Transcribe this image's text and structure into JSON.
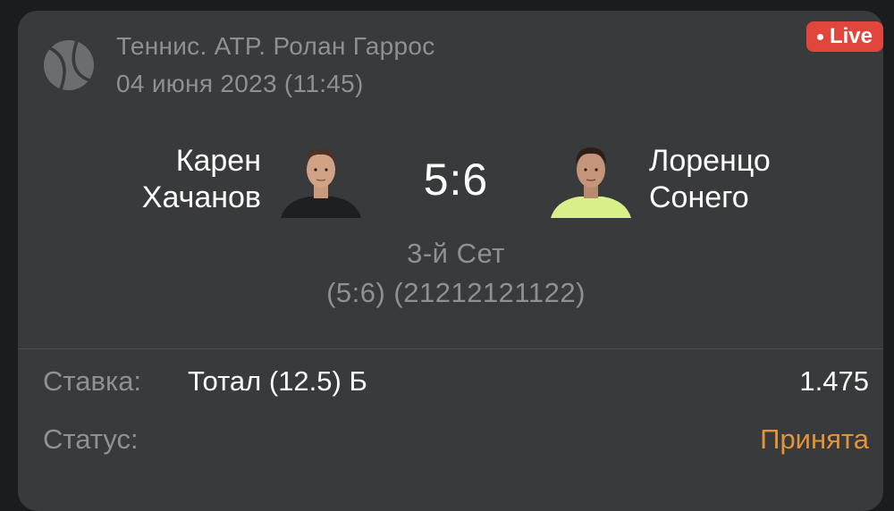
{
  "event": {
    "league": "Теннис. ATP. Ролан Гаррос",
    "datetime": "04 июня 2023 (11:45)",
    "live_label": "Live",
    "sport_icon": "tennis-ball-icon"
  },
  "match": {
    "player_left": {
      "first_name": "Карен",
      "last_name": "Хачанов",
      "shirt_color": "#1e1f21"
    },
    "player_right": {
      "first_name": "Лоренцо",
      "last_name": "Сонего",
      "shirt_color": "#d8ef8a"
    },
    "score": "5:6",
    "set_label": "3-й Сет",
    "set_games": "(5:6) (21212121122)"
  },
  "bet": {
    "label": "Ставка:",
    "value": "Тотал (12.5) Б",
    "odds": "1.475"
  },
  "status": {
    "label": "Статус:",
    "value": "Принята"
  },
  "colors": {
    "background": "#1b1c1e",
    "card": "#383a3c",
    "muted_text": "#8e9092",
    "live_badge": "#e0463c",
    "status_accepted": "#e3943a"
  }
}
